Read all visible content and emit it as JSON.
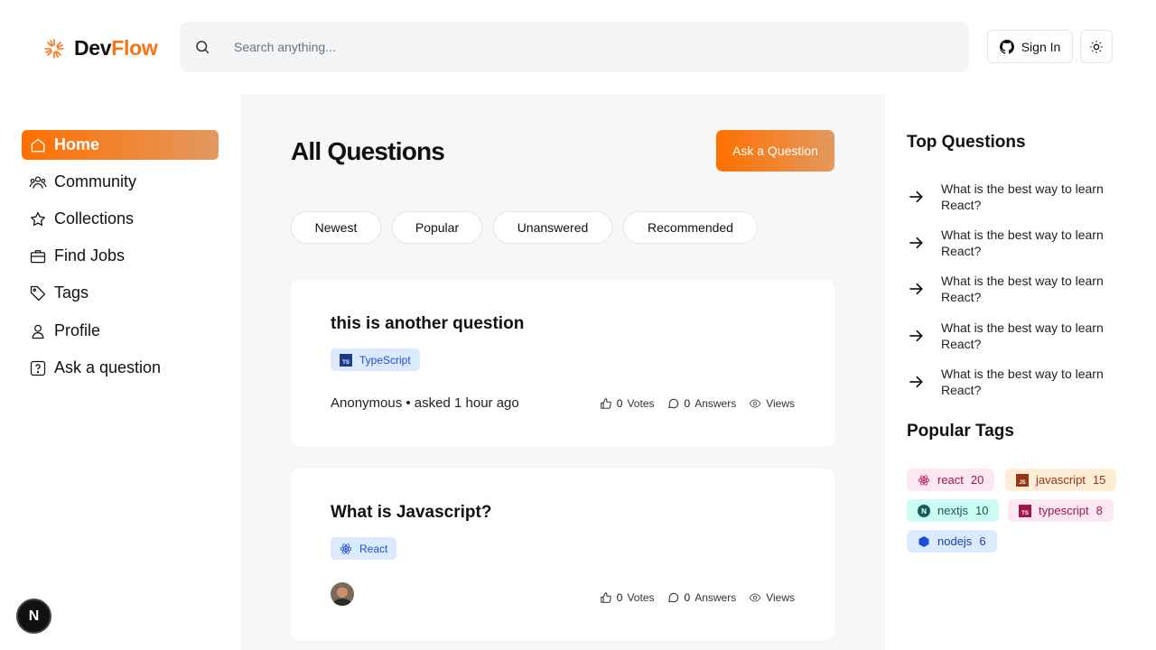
{
  "app": {
    "brand_dev": "Dev",
    "brand_flow": "Flow"
  },
  "colors": {
    "accent": "#ff7000",
    "accent_gradient_end": "#e2995f"
  },
  "search": {
    "placeholder": "Search anything..."
  },
  "header": {
    "signin_label": "Sign In"
  },
  "sidebar": {
    "items": [
      {
        "label": "Home",
        "icon": "home-icon",
        "active": true
      },
      {
        "label": "Community",
        "icon": "users-icon"
      },
      {
        "label": "Collections",
        "icon": "star-icon"
      },
      {
        "label": "Find Jobs",
        "icon": "briefcase-icon"
      },
      {
        "label": "Tags",
        "icon": "tag-icon"
      },
      {
        "label": "Profile",
        "icon": "user-icon"
      },
      {
        "label": "Ask a question",
        "icon": "question-icon"
      }
    ]
  },
  "main": {
    "title": "All Questions",
    "ask_button": "Ask a Question",
    "filters": [
      "Newest",
      "Popular",
      "Unanswered",
      "Recommended"
    ],
    "questions": [
      {
        "title": "this is another question",
        "tag": "TypeScript",
        "author": "Anonymous",
        "asked": "• asked 1 hour ago",
        "votes": "0",
        "votes_label": "Votes",
        "answers": "0",
        "answers_label": "Answers",
        "views_label": "Views"
      },
      {
        "title": "What is Javascript?",
        "tag": "React",
        "votes": "0",
        "votes_label": "Votes",
        "answers": "0",
        "answers_label": "Answers",
        "views_label": "Views"
      }
    ]
  },
  "rightbar": {
    "top_heading": "Top Questions",
    "top_questions": [
      "What is the best way to learn React?",
      "What is the best way to learn React?",
      "What is the best way to learn React?",
      "What is the best way to learn React?",
      "What is the best way to learn React?"
    ],
    "tags_heading": "Popular Tags",
    "tags": [
      {
        "name": "react",
        "count": "20",
        "icon": "react-icon"
      },
      {
        "name": "javascript",
        "count": "15",
        "icon": "js-icon"
      },
      {
        "name": "nextjs",
        "count": "10",
        "icon": "nextjs-icon"
      },
      {
        "name": "typescript",
        "count": "8",
        "icon": "ts-icon"
      },
      {
        "name": "nodejs",
        "count": "6",
        "icon": "nodejs-icon"
      }
    ]
  },
  "dev_badge": "N"
}
